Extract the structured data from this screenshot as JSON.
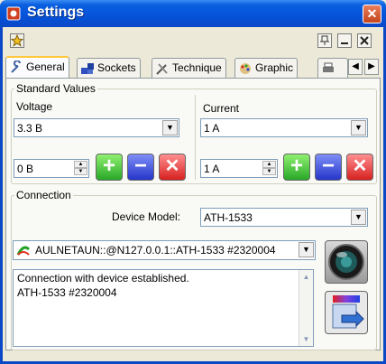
{
  "window": {
    "title": "Settings",
    "close_glyph": "✕"
  },
  "toolbar": {
    "icons": [
      "star-icon"
    ]
  },
  "window_buttons": {
    "pin": "pin-icon",
    "minimize": "minimize-icon",
    "close": "close-icon"
  },
  "tabs": [
    {
      "label": "General",
      "icon": "wrench-icon"
    },
    {
      "label": "Sockets",
      "icon": "cubes-icon"
    },
    {
      "label": "Technique",
      "icon": "tools-icon"
    },
    {
      "label": "Graphic",
      "icon": "palette-icon"
    },
    {
      "label": "",
      "icon": "printer-icon"
    }
  ],
  "tab_scroll": {
    "left": "◀",
    "right": "▶"
  },
  "standard_values": {
    "title": "Standard Values",
    "voltage": {
      "label": "Voltage",
      "value": "3.3 B",
      "spin_value": "0 B"
    },
    "current": {
      "label": "Current",
      "value": "1 A",
      "spin_value": "1 A"
    }
  },
  "connection": {
    "title": "Connection",
    "device_model_label": "Device Model:",
    "device_model_value": "ATH-1533",
    "port_value": "AULNETAUN::@N127.0.0.1::ATH-1533 #2320004",
    "log": [
      "Connection with device established.",
      "ATH-1533 #2320004"
    ]
  },
  "glyphs": {
    "down": "▼",
    "up": "▲",
    "plus": "+",
    "minus": "−",
    "delete": "✕"
  },
  "colors": {
    "title_bar": "#0552d8",
    "plus": "#28a828",
    "minus": "#2535c8",
    "delete": "#d82020",
    "active_tab": "#ffc83c"
  }
}
